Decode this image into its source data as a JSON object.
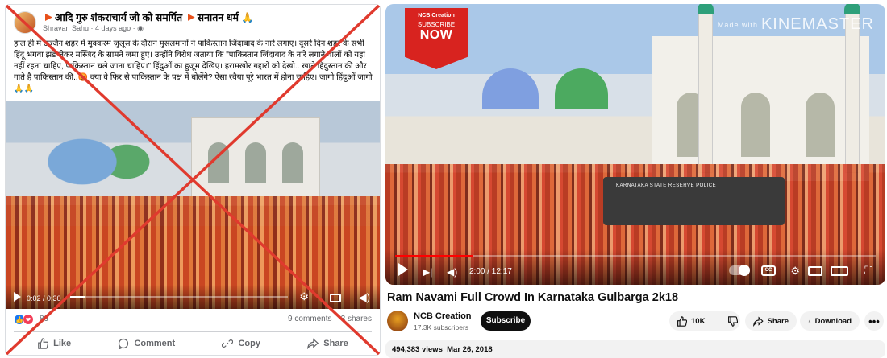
{
  "facebook": {
    "page_name": "आदि गुरु शंकराचार्य जी को समर्पित",
    "page_name_suffix": "सनातन धर्म 🙏",
    "author": "Shravan Sahu",
    "time_ago": "4 days ago",
    "post_text": "हाल ही में उज्जैन शहर में मुक्करम जुलूस के दौरान मुसलमानों ने पाकिस्तान जिंदाबाद के नारे लगाए। दूसरे दिन शहर के सभी हिंदू भगवा झंडे लेकर मस्जिद के सामने जमा हुए। उन्होंने विरोध जताया कि \"पाकिस्तान जिंदाबाद के नारे लगाने वालों को यहां नहीं रहना चाहिए, पाकिस्तान चले जाना चाहिए।\" हिंदुओं का हुजूम देखिए। हरामखोर गद्दारों को देखो.. खाते हिंदुस्तान की और गाते है पाकिस्तान की..😡 क्या वे फिर से पाकिस्तान के पक्ष में बोलेंगे? ऐसा रवैया पूरे भारत में होना चाहिए। जागो हिंदुओं जागो 🙏🙏",
    "video_time": "0:02 / 0:30",
    "video_progress": 0.07,
    "reaction_count": "89",
    "comments": "9 comments",
    "shares": "3 shares",
    "actions": {
      "like": "Like",
      "comment": "Comment",
      "copy": "Copy",
      "share": "Share"
    },
    "overlay_color": "#e03a2e"
  },
  "youtube": {
    "badge": {
      "top": "NCB Creation",
      "middle": "SUBSCRIBE",
      "bottom": "NOW"
    },
    "watermark_small": "Made with",
    "watermark": "KINEMASTER",
    "bus_text": "KARNATAKA STATE RESERVE POLICE",
    "time": "2:00 / 12:17",
    "progress": 0.163,
    "title": "Ram Navami Full Crowd In Karnataka Gulbarga 2k18",
    "channel": "NCB Creation",
    "subscribers": "17.3K subscribers",
    "subscribe_label": "Subscribe",
    "likes": "10K",
    "share_label": "Share",
    "download_label": "Download",
    "views": "494,383 views",
    "date": "Mar 26, 2018",
    "accent": "#ff0000"
  }
}
